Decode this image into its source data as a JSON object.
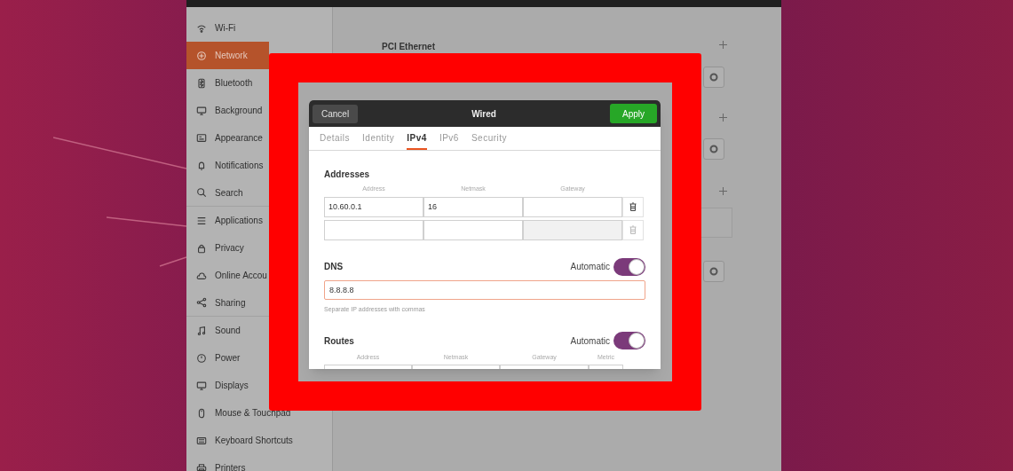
{
  "sidebar": {
    "items": [
      {
        "label": "Wi-Fi",
        "selected": false
      },
      {
        "label": "Network",
        "selected": true
      },
      {
        "label": "Bluetooth",
        "selected": false
      },
      {
        "label": "Background",
        "selected": false
      },
      {
        "label": "Appearance",
        "selected": false
      },
      {
        "label": "Notifications",
        "selected": false
      },
      {
        "label": "Search",
        "selected": false
      },
      {
        "label": "Applications",
        "selected": false
      },
      {
        "label": "Privacy",
        "selected": false
      },
      {
        "label": "Online Accou",
        "selected": false
      },
      {
        "label": "Sharing",
        "selected": false
      },
      {
        "label": "Sound",
        "selected": false
      },
      {
        "label": "Power",
        "selected": false
      },
      {
        "label": "Displays",
        "selected": false
      },
      {
        "label": "Mouse & Touchpad",
        "selected": false
      },
      {
        "label": "Keyboard Shortcuts",
        "selected": false
      },
      {
        "label": "Printers",
        "selected": false
      }
    ]
  },
  "main": {
    "section_title": "PCI Ethernet"
  },
  "dialog": {
    "cancel": "Cancel",
    "title": "Wired",
    "apply": "Apply",
    "tabs": [
      {
        "label": "Details",
        "selected": false
      },
      {
        "label": "Identity",
        "selected": false
      },
      {
        "label": "IPv4",
        "selected": true
      },
      {
        "label": "IPv6",
        "selected": false
      },
      {
        "label": "Security",
        "selected": false
      }
    ],
    "addresses": {
      "title": "Addresses",
      "columns": [
        "Address",
        "Netmask",
        "Gateway"
      ],
      "rows": [
        {
          "cells": [
            "10.60.0.1",
            "16",
            ""
          ],
          "delete_enabled": true
        },
        {
          "cells": [
            "",
            "",
            ""
          ],
          "delete_enabled": false
        }
      ]
    },
    "dns": {
      "title": "DNS",
      "automatic_label": "Automatic",
      "automatic": true,
      "value": "8.8.8.8",
      "hint": "Separate IP addresses with commas"
    },
    "routes": {
      "title": "Routes",
      "automatic_label": "Automatic",
      "automatic": true,
      "columns": [
        "Address",
        "Netmask",
        "Gateway",
        "Metric"
      ]
    }
  }
}
